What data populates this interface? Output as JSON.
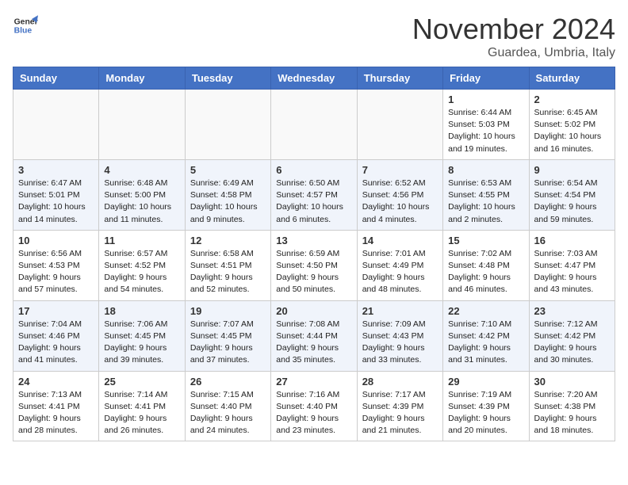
{
  "logo": {
    "line1": "General",
    "line2": "Blue"
  },
  "title": "November 2024",
  "location": "Guardea, Umbria, Italy",
  "days_of_week": [
    "Sunday",
    "Monday",
    "Tuesday",
    "Wednesday",
    "Thursday",
    "Friday",
    "Saturday"
  ],
  "weeks": [
    [
      {
        "day": "",
        "info": ""
      },
      {
        "day": "",
        "info": ""
      },
      {
        "day": "",
        "info": ""
      },
      {
        "day": "",
        "info": ""
      },
      {
        "day": "",
        "info": ""
      },
      {
        "day": "1",
        "info": "Sunrise: 6:44 AM\nSunset: 5:03 PM\nDaylight: 10 hours\nand 19 minutes."
      },
      {
        "day": "2",
        "info": "Sunrise: 6:45 AM\nSunset: 5:02 PM\nDaylight: 10 hours\nand 16 minutes."
      }
    ],
    [
      {
        "day": "3",
        "info": "Sunrise: 6:47 AM\nSunset: 5:01 PM\nDaylight: 10 hours\nand 14 minutes."
      },
      {
        "day": "4",
        "info": "Sunrise: 6:48 AM\nSunset: 5:00 PM\nDaylight: 10 hours\nand 11 minutes."
      },
      {
        "day": "5",
        "info": "Sunrise: 6:49 AM\nSunset: 4:58 PM\nDaylight: 10 hours\nand 9 minutes."
      },
      {
        "day": "6",
        "info": "Sunrise: 6:50 AM\nSunset: 4:57 PM\nDaylight: 10 hours\nand 6 minutes."
      },
      {
        "day": "7",
        "info": "Sunrise: 6:52 AM\nSunset: 4:56 PM\nDaylight: 10 hours\nand 4 minutes."
      },
      {
        "day": "8",
        "info": "Sunrise: 6:53 AM\nSunset: 4:55 PM\nDaylight: 10 hours\nand 2 minutes."
      },
      {
        "day": "9",
        "info": "Sunrise: 6:54 AM\nSunset: 4:54 PM\nDaylight: 9 hours\nand 59 minutes."
      }
    ],
    [
      {
        "day": "10",
        "info": "Sunrise: 6:56 AM\nSunset: 4:53 PM\nDaylight: 9 hours\nand 57 minutes."
      },
      {
        "day": "11",
        "info": "Sunrise: 6:57 AM\nSunset: 4:52 PM\nDaylight: 9 hours\nand 54 minutes."
      },
      {
        "day": "12",
        "info": "Sunrise: 6:58 AM\nSunset: 4:51 PM\nDaylight: 9 hours\nand 52 minutes."
      },
      {
        "day": "13",
        "info": "Sunrise: 6:59 AM\nSunset: 4:50 PM\nDaylight: 9 hours\nand 50 minutes."
      },
      {
        "day": "14",
        "info": "Sunrise: 7:01 AM\nSunset: 4:49 PM\nDaylight: 9 hours\nand 48 minutes."
      },
      {
        "day": "15",
        "info": "Sunrise: 7:02 AM\nSunset: 4:48 PM\nDaylight: 9 hours\nand 46 minutes."
      },
      {
        "day": "16",
        "info": "Sunrise: 7:03 AM\nSunset: 4:47 PM\nDaylight: 9 hours\nand 43 minutes."
      }
    ],
    [
      {
        "day": "17",
        "info": "Sunrise: 7:04 AM\nSunset: 4:46 PM\nDaylight: 9 hours\nand 41 minutes."
      },
      {
        "day": "18",
        "info": "Sunrise: 7:06 AM\nSunset: 4:45 PM\nDaylight: 9 hours\nand 39 minutes."
      },
      {
        "day": "19",
        "info": "Sunrise: 7:07 AM\nSunset: 4:45 PM\nDaylight: 9 hours\nand 37 minutes."
      },
      {
        "day": "20",
        "info": "Sunrise: 7:08 AM\nSunset: 4:44 PM\nDaylight: 9 hours\nand 35 minutes."
      },
      {
        "day": "21",
        "info": "Sunrise: 7:09 AM\nSunset: 4:43 PM\nDaylight: 9 hours\nand 33 minutes."
      },
      {
        "day": "22",
        "info": "Sunrise: 7:10 AM\nSunset: 4:42 PM\nDaylight: 9 hours\nand 31 minutes."
      },
      {
        "day": "23",
        "info": "Sunrise: 7:12 AM\nSunset: 4:42 PM\nDaylight: 9 hours\nand 30 minutes."
      }
    ],
    [
      {
        "day": "24",
        "info": "Sunrise: 7:13 AM\nSunset: 4:41 PM\nDaylight: 9 hours\nand 28 minutes."
      },
      {
        "day": "25",
        "info": "Sunrise: 7:14 AM\nSunset: 4:41 PM\nDaylight: 9 hours\nand 26 minutes."
      },
      {
        "day": "26",
        "info": "Sunrise: 7:15 AM\nSunset: 4:40 PM\nDaylight: 9 hours\nand 24 minutes."
      },
      {
        "day": "27",
        "info": "Sunrise: 7:16 AM\nSunset: 4:40 PM\nDaylight: 9 hours\nand 23 minutes."
      },
      {
        "day": "28",
        "info": "Sunrise: 7:17 AM\nSunset: 4:39 PM\nDaylight: 9 hours\nand 21 minutes."
      },
      {
        "day": "29",
        "info": "Sunrise: 7:19 AM\nSunset: 4:39 PM\nDaylight: 9 hours\nand 20 minutes."
      },
      {
        "day": "30",
        "info": "Sunrise: 7:20 AM\nSunset: 4:38 PM\nDaylight: 9 hours\nand 18 minutes."
      }
    ]
  ]
}
